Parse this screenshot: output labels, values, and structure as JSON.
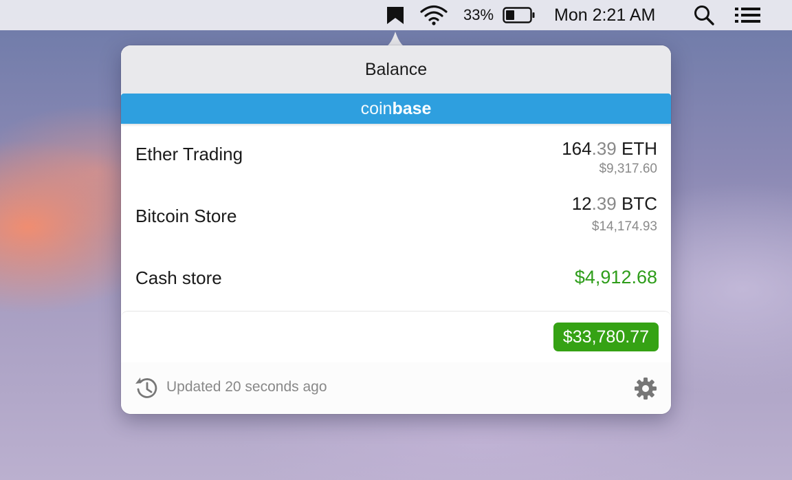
{
  "menubar": {
    "battery_percent": "33%",
    "clock": "Mon 2:21 AM",
    "icons": [
      "bookmark-icon",
      "wifi-icon",
      "battery-icon",
      "search-icon",
      "list-icon"
    ]
  },
  "popover": {
    "title": "Balance",
    "brand": {
      "light": "coin",
      "bold": "base",
      "color": "#2e9fdf"
    },
    "accounts": [
      {
        "name": "Ether Trading",
        "amount_int": "164",
        "amount_dec": ".39",
        "currency": "ETH",
        "usd": "$9,317.60"
      },
      {
        "name": "Bitcoin Store",
        "amount_int": "12",
        "amount_dec": ".39",
        "currency": "BTC",
        "usd": "$14,174.93"
      },
      {
        "name": "Cash store",
        "amount": "$4,912.68"
      }
    ],
    "total": "$33,780.77",
    "footer": {
      "updated": "Updated 20 seconds ago"
    },
    "colors": {
      "positive": "#2e9d1a",
      "total_badge": "#35a214"
    }
  }
}
